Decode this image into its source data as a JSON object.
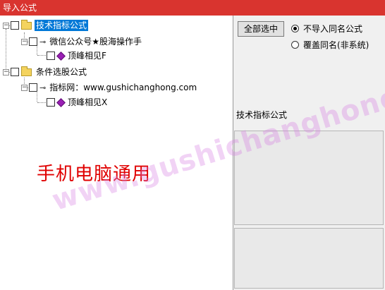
{
  "window": {
    "title": "导入公式"
  },
  "tree": {
    "nodes": [
      {
        "label": "技术指标公式",
        "expander": "−"
      },
      {
        "label": "微信公众号★股海操作手",
        "expander": "−"
      },
      {
        "label": "顶峰相见F"
      },
      {
        "label": "条件选股公式",
        "expander": "−"
      },
      {
        "label": "指标网：www.gushichanghong.com",
        "expander": "−"
      },
      {
        "label": "顶峰相见X"
      }
    ]
  },
  "overlay": {
    "red_text": "手机电脑通用",
    "watermark": "www.gushichanghong.com"
  },
  "controls": {
    "select_all_label": "全部选中",
    "radio_options": [
      {
        "label": "不导入同名公式",
        "checked": true
      },
      {
        "label": "覆盖同名(非系统)",
        "checked": false
      }
    ]
  },
  "detail": {
    "section_label": "技术指标公式"
  },
  "colors": {
    "titlebar": "#d9342f",
    "selection": "#0078d7",
    "red_text": "#e00000",
    "formula_icon": "#9a1fb5",
    "folder": "#f4d35e"
  }
}
